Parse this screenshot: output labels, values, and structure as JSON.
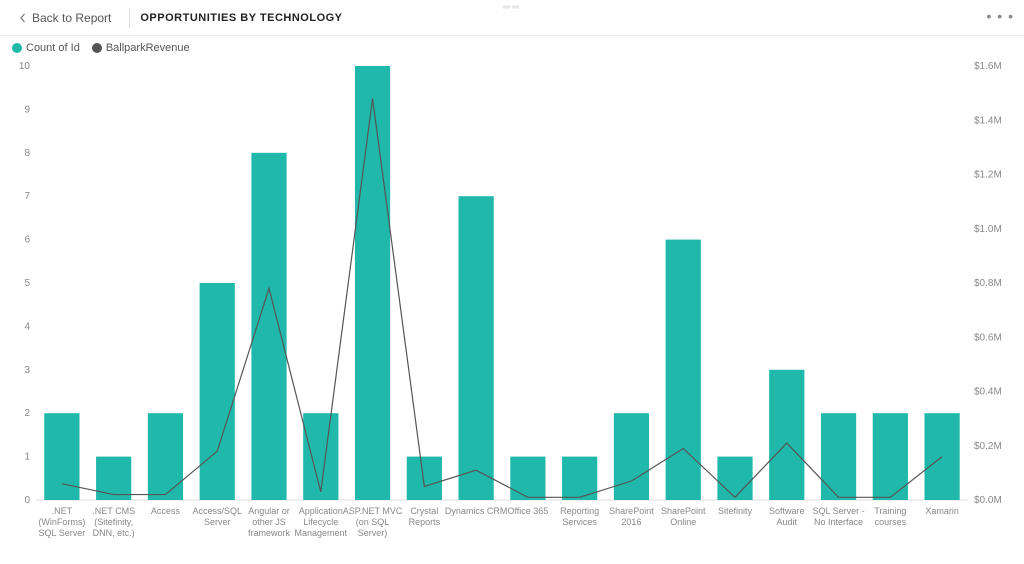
{
  "header": {
    "back_label": "Back to Report",
    "title": "OPPORTUNITIES BY TECHNOLOGY"
  },
  "legend": {
    "series1": "Count of Id",
    "series2": "BallparkRevenue"
  },
  "chart_data": {
    "type": "bar",
    "title": "Opportunities by Technology",
    "categories": [
      ".NET (WinForms) SQL Server",
      ".NET CMS (Sitefinity, DNN, etc.)",
      "Access",
      "Access/SQL Server",
      "Angular or other JS framework",
      "Application Lifecycle Management",
      "ASP.NET MVC (on SQL Server)",
      "Crystal Reports",
      "Dynamics CRM",
      "Office 365",
      "Reporting Services",
      "SharePoint 2016",
      "SharePoint Online",
      "Sitefinity",
      "Software Audit",
      "SQL Server - No Interface",
      "Training courses",
      "Xamarin"
    ],
    "series": [
      {
        "name": "Count of Id",
        "axis": "left",
        "type": "bar",
        "values": [
          2,
          1,
          2,
          5,
          8,
          2,
          10,
          1,
          7,
          1,
          1,
          2,
          6,
          1,
          3,
          2,
          2,
          2
        ]
      },
      {
        "name": "BallparkRevenue",
        "axis": "right",
        "type": "line",
        "values": [
          60000,
          20000,
          20000,
          180000,
          780000,
          30000,
          1480000,
          50000,
          110000,
          10000,
          10000,
          70000,
          190000,
          10000,
          210000,
          10000,
          10000,
          160000
        ]
      }
    ],
    "y_left": {
      "label": "",
      "min": 0,
      "max": 10,
      "ticks": [
        0,
        1,
        2,
        3,
        4,
        5,
        6,
        7,
        8,
        9,
        10
      ]
    },
    "y_right": {
      "label": "",
      "min": 0,
      "max": 1600000,
      "ticks": [
        "$0.0M",
        "$0.2M",
        "$0.4M",
        "$0.6M",
        "$0.8M",
        "$1.0M",
        "$1.2M",
        "$1.4M",
        "$1.6M"
      ]
    },
    "colors": {
      "bar": "#1fb8aa",
      "line": "#555555"
    }
  }
}
